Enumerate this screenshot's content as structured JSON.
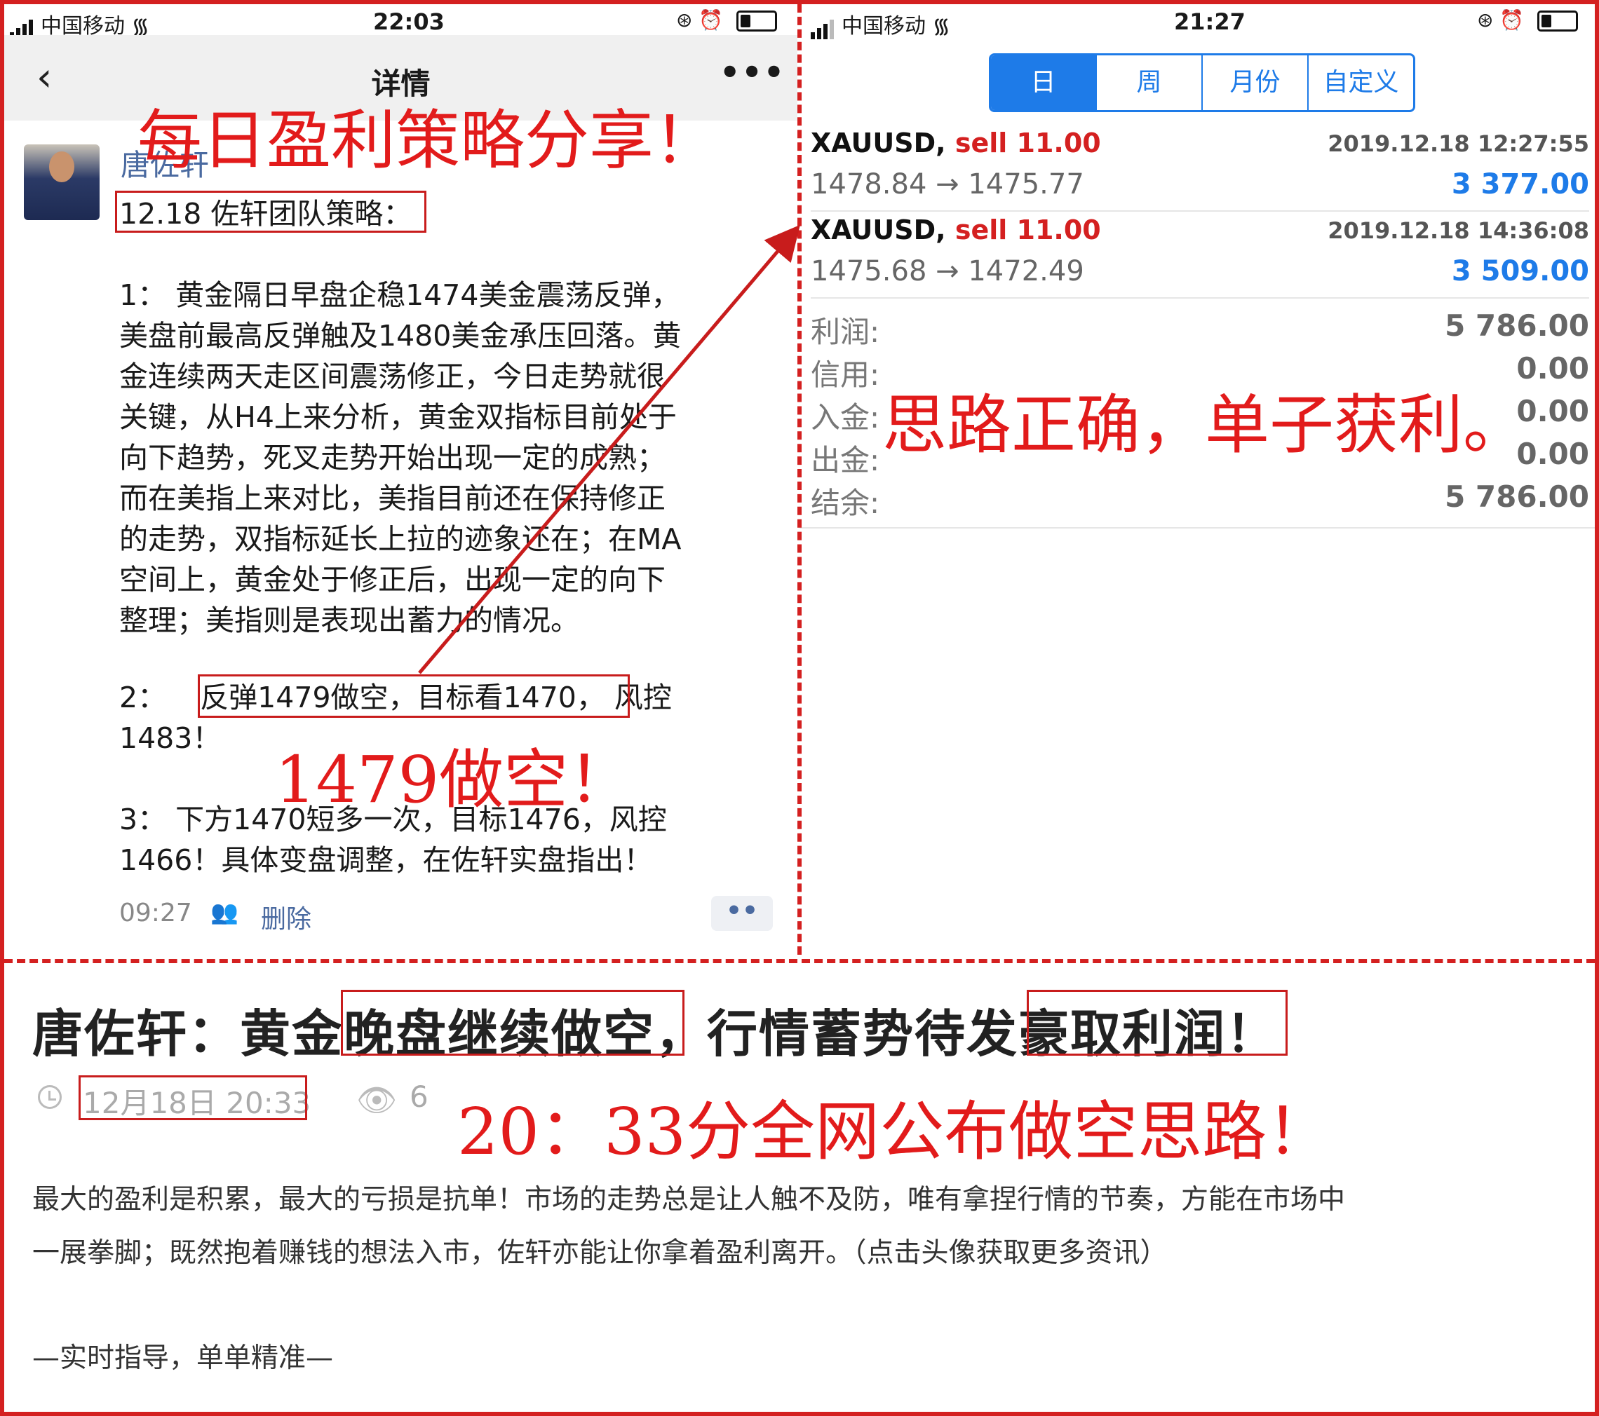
{
  "left_phone": {
    "status": {
      "carrier": "中国移动",
      "time": "22:03"
    },
    "nav": {
      "back": "‹",
      "title": "详情",
      "more": "•••"
    },
    "post": {
      "author": "唐佐轩",
      "heading": "12.18 佐轩团队策略：",
      "lines": [
        "  1：  黄金隔日早盘企稳1474美金震荡反弹，",
        "美盘前最高反弹触及1480美金承压回落。黄",
        "金连续两天走区间震荡修正，今日走势就很",
        "关键，从H4上来分析，黄金双指标目前处于",
        "向下趋势，死叉走势开始出现一定的成熟；",
        "而在美指上来对比，美指目前还在保持修正",
        "的走势，双指标延长上拉的迹象还在；在MA",
        "空间上，黄金处于修正后，出现一定的向下",
        "整理；美指则是表现出蓄力的情况。"
      ],
      "point2_prefix": "  2：",
      "point2_highlight": "反弹1479做空，目标看1470，",
      "point2_suffix": "风控",
      "point2_line2": "1483！",
      "point3_line1": "  3：  下方1470短多一次，目标1476，风控",
      "point3_line2": "1466！具体变盘调整，在佐轩实盘指出！",
      "time": "09:27",
      "delete": "删除",
      "more": "••"
    }
  },
  "right_phone": {
    "status": {
      "carrier": "中国移动",
      "time": "21:27"
    },
    "tabs": [
      "日",
      "周",
      "月份",
      "自定义"
    ],
    "active_tab": 0,
    "trades": [
      {
        "symbol": "XAUUSD,",
        "side": "sell 11.00",
        "datetime": "2019.12.18 12:27:55",
        "prices": "1478.84 → 1475.77",
        "profit": "3 377.00"
      },
      {
        "symbol": "XAUUSD,",
        "side": "sell 11.00",
        "datetime": "2019.12.18 14:36:08",
        "prices": "1475.68 → 1472.49",
        "profit": "3 509.00"
      }
    ],
    "summary": [
      {
        "label": "利润:",
        "value": "5 786.00"
      },
      {
        "label": "信用:",
        "value": "0.00"
      },
      {
        "label": "入金:",
        "value": "0.00"
      },
      {
        "label": "出金:",
        "value": "0.00"
      },
      {
        "label": "结余:",
        "value": "5 786.00"
      }
    ]
  },
  "article": {
    "title_a": "唐佐轩：黄金",
    "title_b": "晚盘继续做空",
    "title_c": "，行情蓄势待发",
    "title_d": "豪取利润！",
    "date": "12月18日 20:33",
    "views": "6",
    "paragraph_line1": "      最大的盈利是积累，最大的亏损是抗单！市场的走势总是让人触不及防，唯有拿捏行情的节奏，方能在市场中",
    "paragraph_line2": "一展拳脚；既然抱着赚钱的想法入市，佐轩亦能让你拿着盈利离开。（点击头像获取更多资讯）",
    "motto": "   —实时指导，单单精准—"
  },
  "annotations": {
    "daily": "每日盈利策略分享！",
    "short1479": "1479做空！",
    "correct": "思路正确，单子获利。",
    "publish": "20：33分全网公布做空思路！"
  },
  "colors": {
    "annotation_red": "#e21b1b",
    "tab_blue": "#1e7be8",
    "sell_red": "#d42020"
  }
}
